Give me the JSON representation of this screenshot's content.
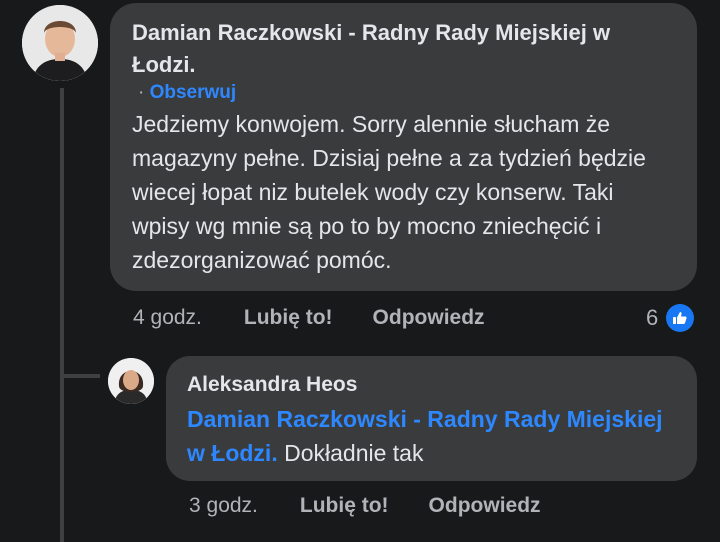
{
  "comment": {
    "author": "Damian Raczkowski - Radny Rady Miejskiej w Łodzi.",
    "follow_separator": "·",
    "follow_label": "Obserwuj",
    "text": "Jedziemy konwojem. Sorry alennie słucham że magazyny pełne. Dzisiaj pełne a za tydzień będzie wiecej łopat niz butelek wody czy konserw. Taki wpisy wg mnie są po to by mocno zniechęcić i zdezorganizować pomóc.",
    "time": "4 godz.",
    "like_label": "Lubię to!",
    "reply_label": "Odpowiedz",
    "reaction_count": "6",
    "reaction_icon": "thumbs-up-icon"
  },
  "reply": {
    "author": "Aleksandra Heos",
    "mention": "Damian Raczkowski - Radny Rady Miejskiej w Łodzi.",
    "text": "Dokładnie tak",
    "time": "3 godz.",
    "like_label": "Lubię to!",
    "reply_label": "Odpowiedz"
  },
  "colors": {
    "background": "#18191a",
    "bubble": "#3a3b3c",
    "text": "#e4e6eb",
    "secondary_text": "#b0b3b8",
    "link": "#2d88ff",
    "like_badge": "#1877f2"
  }
}
